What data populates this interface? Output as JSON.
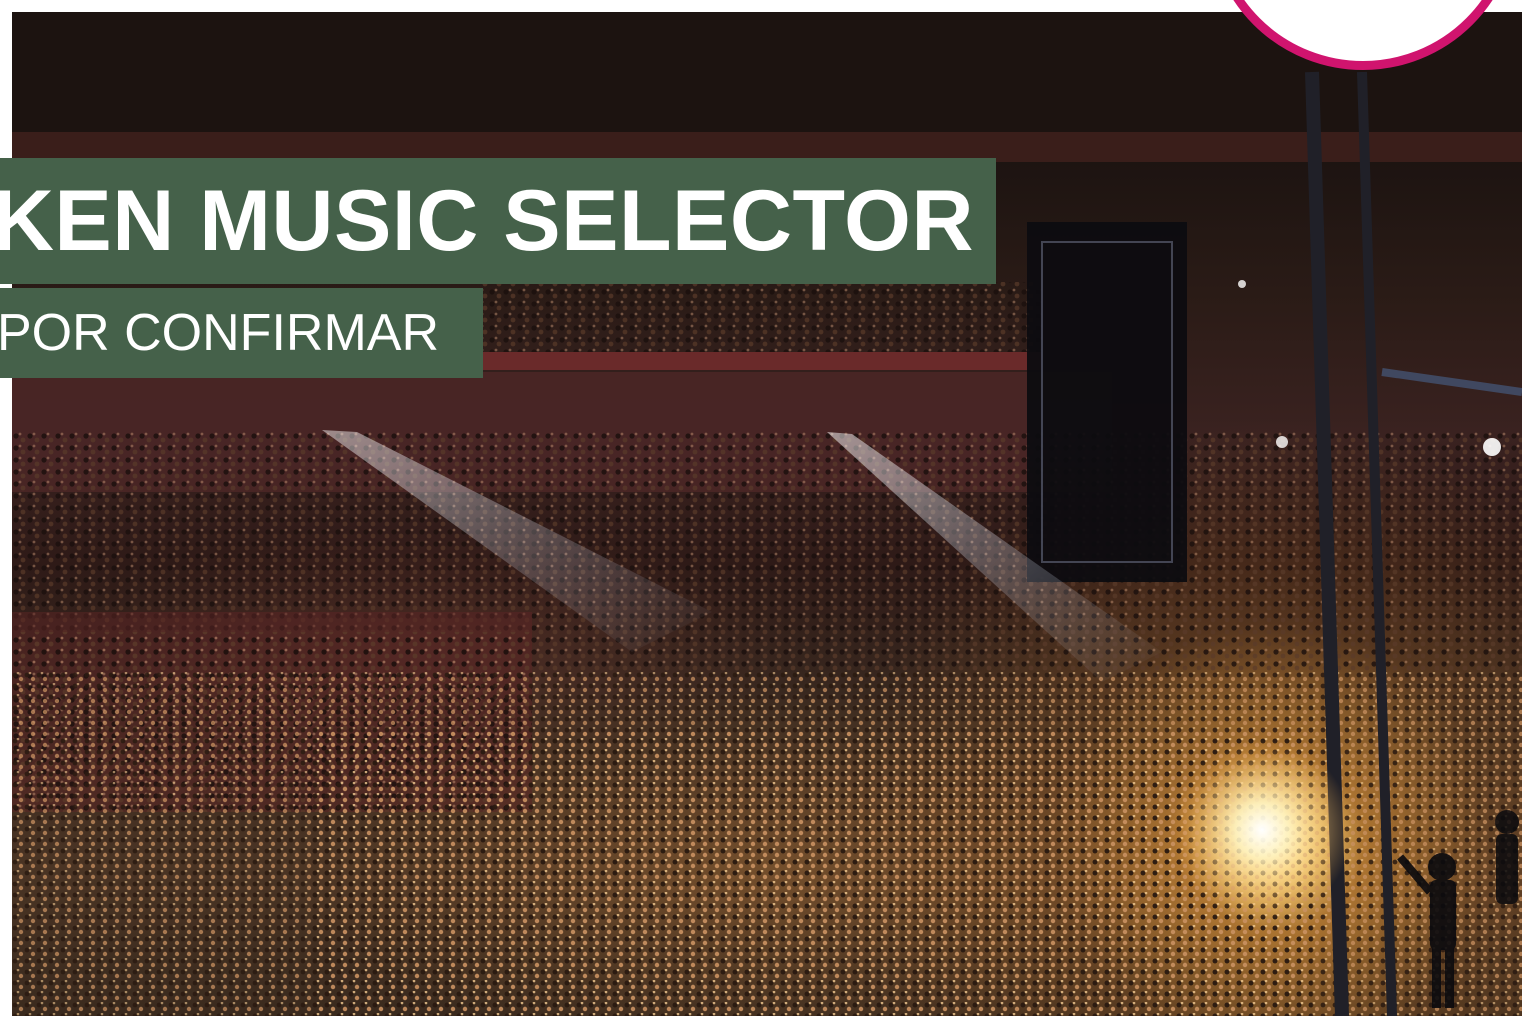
{
  "banner": {
    "title": "KEN MUSIC SELECTOR",
    "subtitle": "POR CONFIRMAR"
  },
  "colors": {
    "banner_green": "#45614a",
    "logo_ring": "#d0146e",
    "text": "#ffffff"
  },
  "photo": {
    "icon": "concert-crowd-image"
  }
}
